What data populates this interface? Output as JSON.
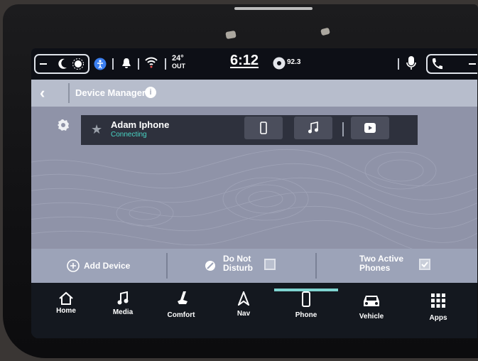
{
  "status_bar": {
    "left_icons": [
      "minus-icon",
      "moon-icon",
      "sun-icon",
      "accessibility-icon",
      "bell-icon",
      "wifi-icon"
    ],
    "temperature_value": "24°",
    "temperature_label": "OUT",
    "clock": "6:12",
    "radio_freq": "92.3",
    "right_icons": [
      "microphone-icon",
      "phone-icon",
      "minus-icon"
    ]
  },
  "header": {
    "title": "Device Manager"
  },
  "device": {
    "name": "Adam Iphone",
    "status": "Connecting",
    "action_icons": [
      "phone-device-icon",
      "music-note-icon",
      "projection-icon"
    ]
  },
  "actions": {
    "add_device_label": "Add Device",
    "do_not_disturb_label_1": "Do Not",
    "do_not_disturb_label_2": "Disturb",
    "do_not_disturb_checked": false,
    "two_active_label_1": "Two Active",
    "two_active_label_2": "Phones",
    "two_active_checked": true
  },
  "nav": {
    "items": [
      {
        "label": "Home",
        "icon": "home-icon"
      },
      {
        "label": "Media",
        "icon": "music-icon"
      },
      {
        "label": "Comfort",
        "icon": "seat-icon"
      },
      {
        "label": "Nav",
        "icon": "nav-arrow-icon"
      },
      {
        "label": "Phone",
        "icon": "phone-device-icon"
      },
      {
        "label": "Vehicle",
        "icon": "car-icon"
      },
      {
        "label": "Apps",
        "icon": "grid-icon"
      }
    ],
    "active": "Phone"
  },
  "colors": {
    "connecting_accent": "#49d6c6",
    "active_tab_accent": "#7fd4d0"
  }
}
